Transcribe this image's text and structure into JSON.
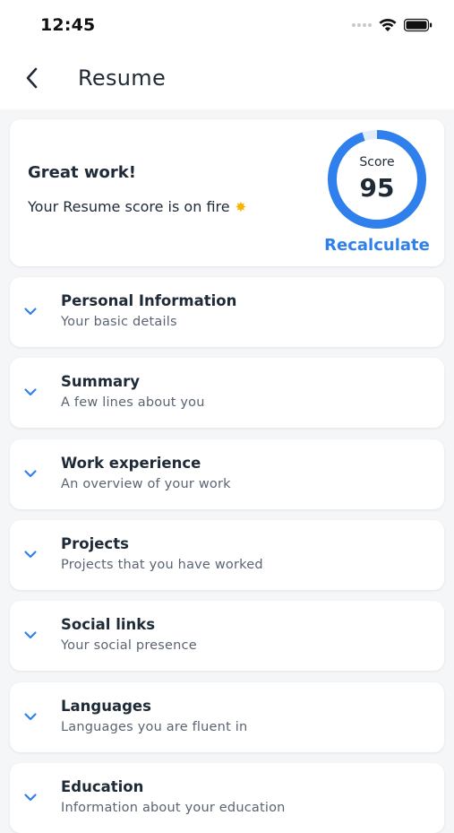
{
  "status_bar": {
    "time": "12:45"
  },
  "header": {
    "title": "Resume",
    "back_icon": "chevron-left-icon"
  },
  "score_card": {
    "heading": "Great work!",
    "message": "Your Resume score is on fire",
    "message_icon": "sparkle-icon",
    "score_label": "Score",
    "score_value": "95",
    "score_fraction": 0.95,
    "recalculate_label": "Recalculate"
  },
  "sections": [
    {
      "title": "Personal Information",
      "subtitle": "Your basic details",
      "icon": "chevron-down-icon"
    },
    {
      "title": "Summary",
      "subtitle": "A few lines about you",
      "icon": "chevron-down-icon"
    },
    {
      "title": "Work experience",
      "subtitle": "An overview of your work",
      "icon": "chevron-down-icon"
    },
    {
      "title": "Projects",
      "subtitle": "Projects that you have worked",
      "icon": "chevron-down-icon"
    },
    {
      "title": "Social links",
      "subtitle": "Your social presence",
      "icon": "chevron-down-icon"
    },
    {
      "title": "Languages",
      "subtitle": "Languages you are fluent in",
      "icon": "chevron-down-icon"
    },
    {
      "title": "Education",
      "subtitle": "Information about your education",
      "icon": "chevron-down-icon"
    }
  ],
  "colors": {
    "accent": "#2f80ed",
    "ring_track": "#e3ecfb",
    "background": "#f5f6f8",
    "card": "#ffffff",
    "text_primary": "#1f2a37",
    "text_secondary": "#5b6472"
  }
}
